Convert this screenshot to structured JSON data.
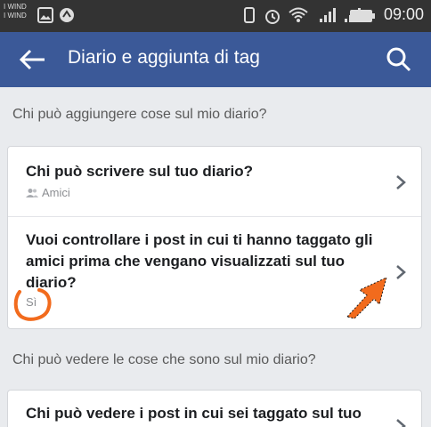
{
  "status_bar": {
    "carrier_1": "I WIND",
    "carrier_2": "I WIND",
    "time": "09:00"
  },
  "app_bar": {
    "title": "Diario e aggiunta di tag",
    "back_icon": "arrow-left-icon",
    "search_icon": "search-icon"
  },
  "section_1": {
    "title": "Chi può aggiungere cose sul mio diario?",
    "rows": [
      {
        "title": "Chi può scrivere sul tuo diario?",
        "value": "Amici",
        "value_icon": "friends-icon"
      },
      {
        "title_line_1": "Vuoi controllare i post in cui ti hanno taggato gli",
        "title_line_2": "amici prima che vengano visualizzati sul tuo",
        "title_line_3": "diario?",
        "value": "Sì"
      }
    ]
  },
  "section_2": {
    "title": "Chi può vedere le cose che sono sul mio diario?",
    "rows": [
      {
        "title": "Chi può vedere i post in cui sei taggato sul tuo"
      }
    ]
  },
  "colors": {
    "app_bar": "#3b5998",
    "status_bar": "#333333",
    "background": "#e9ebee",
    "annotation": "#f26b1d"
  }
}
